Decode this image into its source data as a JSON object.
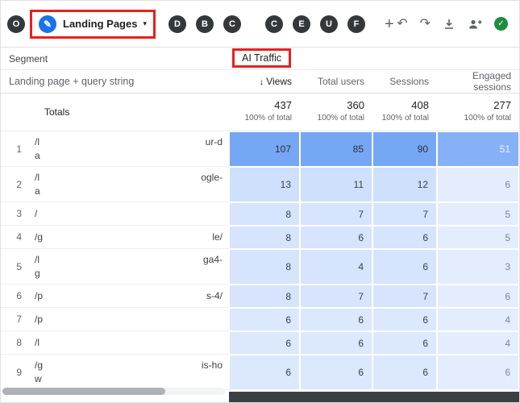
{
  "tabbar": {
    "first_tab": "O",
    "active_tab": {
      "label": "Landing Pages"
    },
    "tabs": [
      "D",
      "B",
      "C",
      "C",
      "E",
      "U",
      "F"
    ],
    "add_label": "+"
  },
  "icons": {
    "pencil": "✎",
    "caret": "▾",
    "sort_desc": "↓",
    "undo": "↶",
    "redo": "↷",
    "check": "✓"
  },
  "toolbar_icon_names": [
    "undo-icon",
    "redo-icon",
    "download-icon",
    "share-add-user-icon",
    "approval-check-icon"
  ],
  "header": {
    "segment_label": "Segment",
    "ai_traffic_label": "AI Traffic",
    "dimension_label": "Landing page + query string"
  },
  "columns": [
    {
      "label": "Views",
      "sorted": true
    },
    {
      "label": "Total users"
    },
    {
      "label": "Sessions"
    },
    {
      "label": "Engaged sessions"
    }
  ],
  "totals": {
    "label": "Totals",
    "values": [
      "437",
      "360",
      "408",
      "277"
    ],
    "pct": "100% of total"
  },
  "rows": [
    {
      "num": "1",
      "prefix": "/l",
      "suffix": "ur-d",
      "line2": "a",
      "values": [
        "107",
        "85",
        "90",
        "51"
      ]
    },
    {
      "num": "2",
      "prefix": "/l",
      "suffix": "ogle-",
      "line2": "a",
      "values": [
        "13",
        "11",
        "12",
        "6"
      ]
    },
    {
      "num": "3",
      "prefix": "/",
      "suffix": "",
      "line2": "",
      "values": [
        "8",
        "7",
        "7",
        "5"
      ]
    },
    {
      "num": "4",
      "prefix": "/g",
      "suffix": "le/",
      "line2": "",
      "values": [
        "8",
        "6",
        "6",
        "5"
      ]
    },
    {
      "num": "5",
      "prefix": "/l",
      "suffix": "ga4-",
      "line2": "g",
      "values": [
        "8",
        "4",
        "6",
        "3"
      ]
    },
    {
      "num": "6",
      "prefix": "/p",
      "suffix": "s-4/",
      "line2": "",
      "values": [
        "8",
        "7",
        "7",
        "6"
      ]
    },
    {
      "num": "7",
      "prefix": "/p",
      "suffix": "",
      "line2": "",
      "values": [
        "6",
        "6",
        "6",
        "4"
      ]
    },
    {
      "num": "8",
      "prefix": "/l",
      "suffix": "",
      "line2": "",
      "values": [
        "6",
        "6",
        "6",
        "4"
      ]
    },
    {
      "num": "9",
      "prefix": "/g",
      "suffix": "is-ho",
      "line2": "w",
      "values": [
        "6",
        "6",
        "6",
        "6"
      ]
    }
  ],
  "palette": {
    "accent_blue": "#1a73e8",
    "annotation_red": "#e8201f",
    "tab_circle": "#35383b",
    "cell_dark": "#76a7f5",
    "cell_dark_engaged": "#87b1f7",
    "cell_light_13": "#cfe0fc",
    "cell_light_8": "#d6e4fd",
    "cell_light_6": "#dbe8fd",
    "cell_engaged_light": "#e3edfe",
    "strip_dark": "#3d4043"
  }
}
